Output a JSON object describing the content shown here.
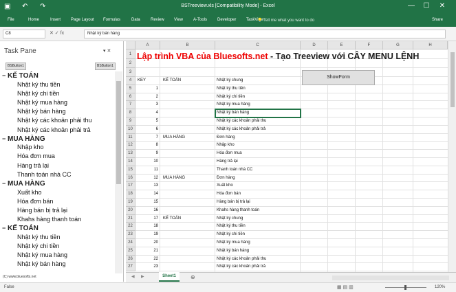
{
  "titlebar": {
    "title": "BSTreeview.xls  [Compatibility Mode]  -  Excel",
    "save_icon": "save-icon",
    "undo": "↶",
    "redo": "↷",
    "min": "—",
    "max": "☐",
    "close": "✕"
  },
  "ribbon": {
    "tabs": [
      "File",
      "Home",
      "Insert",
      "Page Layout",
      "Formulas",
      "Data",
      "Review",
      "View",
      "A-Tools",
      "Developer",
      "TaskView"
    ],
    "tellme": "Tell me what you want to do",
    "share": "Share"
  },
  "formula_bar": {
    "namebox": "C8",
    "fx": "✕  ✓  fx",
    "value": "Nhật ký bán hàng"
  },
  "task_pane": {
    "title": "Task Pane",
    "controls": "▾  ✕",
    "button1": "BSButton1",
    "button2": "BSButton1",
    "status": "(C) www.bluesofts.net",
    "tree": [
      {
        "type": "parent",
        "label": "KẾ TOÁN"
      },
      {
        "type": "child",
        "label": "Nhật ký thu tiền"
      },
      {
        "type": "child",
        "label": "Nhật ký chi tiền"
      },
      {
        "type": "child",
        "label": "Nhật ký mua hàng"
      },
      {
        "type": "child",
        "label": "Nhật ký bán hàng"
      },
      {
        "type": "child",
        "label": "Nhật ký các khoản phải thu"
      },
      {
        "type": "child",
        "label": "Nhật ký các khoản phải trả"
      },
      {
        "type": "parent",
        "label": "MUA HÀNG"
      },
      {
        "type": "child",
        "label": "Nhập kho"
      },
      {
        "type": "child",
        "label": "Hóa đơn mua"
      },
      {
        "type": "child",
        "label": "Hàng trả lại"
      },
      {
        "type": "child",
        "label": "Thanh toán nhà CC"
      },
      {
        "type": "parent",
        "label": "MUA HÀNG"
      },
      {
        "type": "child",
        "label": "Xuất kho"
      },
      {
        "type": "child",
        "label": "Hóa đơn bán"
      },
      {
        "type": "child",
        "label": "Hàng bán bị trả lại"
      },
      {
        "type": "child",
        "label": "Khahs hàng thanh toán"
      },
      {
        "type": "parent",
        "label": "KẾ TOÁN"
      },
      {
        "type": "child",
        "label": "Nhật ký thu tiền"
      },
      {
        "type": "child",
        "label": "Nhật ký chi tiền"
      },
      {
        "type": "child",
        "label": "Nhật ký mua hàng"
      },
      {
        "type": "child",
        "label": "Nhật ký bán hàng"
      }
    ]
  },
  "sheet": {
    "columns": [
      "A",
      "B",
      "C",
      "D",
      "E",
      "F",
      "G",
      "H"
    ],
    "banner_red": "Lập trình VBA của Bluesofts.net",
    "banner_black": " - Tạo Treeview với CÂY MENU LỆNH",
    "showform_label": "ShowForm",
    "header_row": {
      "a": "KEY",
      "b": "KẾ TOÁN",
      "c": "Nhật ký chung"
    },
    "rows": [
      {
        "r": "1"
      },
      {
        "r": "2"
      },
      {
        "r": "3"
      },
      {
        "r": "4",
        "a": "KEY",
        "b": "KẾ TOÁN",
        "c": "Nhật ký chung"
      },
      {
        "r": "5",
        "a": "1",
        "c": "Nhật ký thu tiền"
      },
      {
        "r": "6",
        "a": "2",
        "c": "Nhật ký chi tiền"
      },
      {
        "r": "7",
        "a": "3",
        "c": "Nhật ký mua hàng"
      },
      {
        "r": "8",
        "a": "4",
        "c": "Nhật ký bán hàng"
      },
      {
        "r": "9",
        "a": "5",
        "c": "Nhật ký các khoản phải thu"
      },
      {
        "r": "10",
        "a": "6",
        "c": "Nhật ký các khoản phải trả"
      },
      {
        "r": "11",
        "a": "7",
        "b": "MUA HÀNG",
        "c": "Đơn hàng"
      },
      {
        "r": "12",
        "a": "8",
        "c": "Nhập kho"
      },
      {
        "r": "13",
        "a": "9",
        "c": "Hóa đơn mua"
      },
      {
        "r": "14",
        "a": "10",
        "c": "Hàng trả lại"
      },
      {
        "r": "15",
        "a": "11",
        "c": "Thanh toán nhà CC"
      },
      {
        "r": "16",
        "a": "12",
        "b": "MUA HÀNG",
        "c": "Đơn hàng"
      },
      {
        "r": "17",
        "a": "13",
        "c": "Xuất kho"
      },
      {
        "r": "18",
        "a": "14",
        "c": "Hóa đơn bán"
      },
      {
        "r": "19",
        "a": "15",
        "c": "Hàng bán bị trả lại"
      },
      {
        "r": "20",
        "a": "16",
        "c": "Khahs hàng thanh toán"
      },
      {
        "r": "21",
        "a": "17",
        "b": "KẾ TOÁN",
        "c": "Nhật ký chung"
      },
      {
        "r": "22",
        "a": "18",
        "c": "Nhật ký thu tiền"
      },
      {
        "r": "23",
        "a": "19",
        "c": "Nhật ký chi tiền"
      },
      {
        "r": "24",
        "a": "20",
        "c": "Nhật ký mua hàng"
      },
      {
        "r": "25",
        "a": "21",
        "c": "Nhật ký bán hàng"
      },
      {
        "r": "26",
        "a": "22",
        "c": "Nhật ký các khoản phải thu"
      },
      {
        "r": "27",
        "a": "23",
        "c": "Nhật ký các khoản phải trả"
      }
    ],
    "selected_cell": "C8"
  },
  "sheet_tabs": {
    "prev": "◀",
    "next": "▶",
    "tab": "Sheet1",
    "add": "⊕"
  },
  "status_bar": {
    "ready": "False",
    "views": "▦  ▤  ▥",
    "zoom": "120%"
  },
  "colors": {
    "excel_green": "#217346",
    "banner_red": "#e00000"
  }
}
